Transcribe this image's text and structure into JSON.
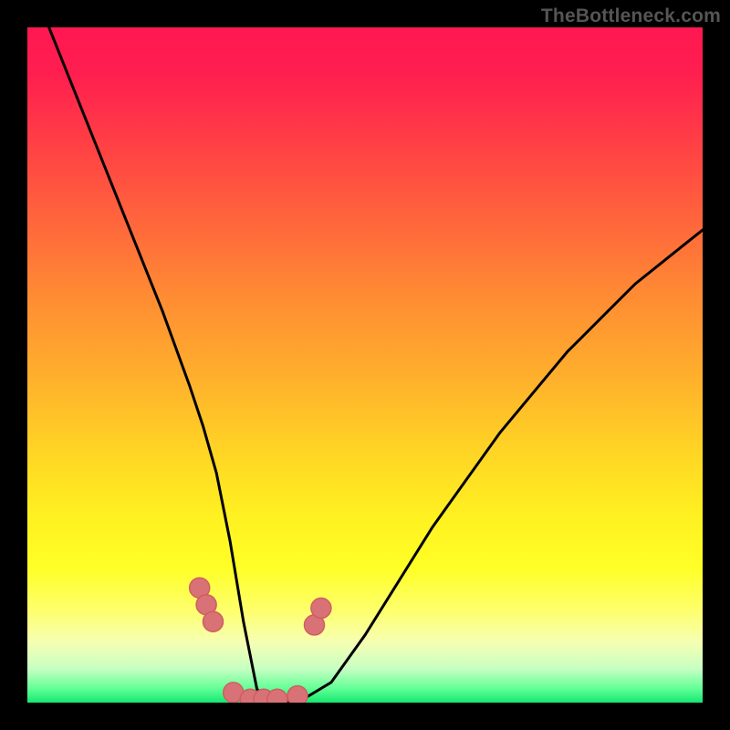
{
  "watermark": "TheBottleneck.com",
  "colors": {
    "background": "#000000",
    "gradient_top": "#ff1751",
    "gradient_bottom": "#14e870",
    "curve": "#000000",
    "marker_fill": "#d87277",
    "marker_stroke": "#ce5e60",
    "watermark_text": "#555555"
  },
  "chart_data": {
    "type": "line",
    "title": "",
    "xlabel": "",
    "ylabel": "",
    "xlim": [
      0,
      100
    ],
    "ylim": [
      0,
      100
    ],
    "grid": false,
    "series": [
      {
        "name": "bottleneck-curve",
        "x": [
          0,
          4,
          8,
          12,
          16,
          20,
          24,
          26,
          28,
          30,
          32,
          34,
          36,
          40,
          45,
          50,
          55,
          60,
          65,
          70,
          75,
          80,
          85,
          90,
          95,
          100
        ],
        "values": [
          108,
          98,
          88,
          78,
          68,
          58,
          47,
          41,
          34,
          24,
          12,
          2,
          0,
          0,
          3,
          10,
          18,
          26,
          33,
          40,
          46,
          52,
          57,
          62,
          66,
          70
        ]
      }
    ],
    "markers": {
      "name": "highlight-points",
      "x": [
        25.5,
        26.5,
        27.5,
        30.5,
        33.0,
        35.0,
        37.0,
        40.0,
        42.5,
        43.5
      ],
      "values": [
        17.0,
        14.5,
        12.0,
        1.5,
        0.5,
        0.5,
        0.5,
        1.0,
        11.5,
        14.0
      ]
    }
  }
}
